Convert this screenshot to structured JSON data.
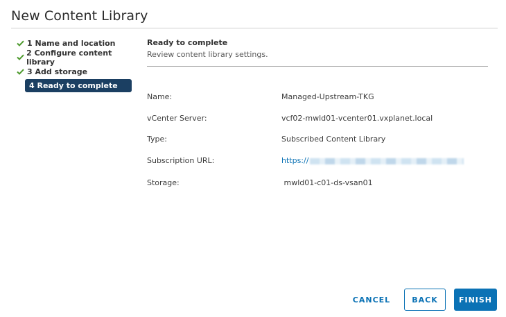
{
  "dialog": {
    "title": "New Content Library"
  },
  "steps": [
    {
      "label": "1 Name and location",
      "status": "completed",
      "icon": "check-icon"
    },
    {
      "label": "2 Configure content library",
      "status": "completed",
      "icon": "check-icon"
    },
    {
      "label": "3 Add storage",
      "status": "completed",
      "icon": "check-icon"
    },
    {
      "label": "4 Ready to complete",
      "status": "active"
    }
  ],
  "section": {
    "heading": "Ready to complete",
    "subheading": "Review content library settings."
  },
  "summary": [
    {
      "label": "Name:",
      "value": "Managed-Upstream-TKG"
    },
    {
      "label": "vCenter Server:",
      "value": "vcf02-mwld01-vcenter01.vxplanet.local"
    },
    {
      "label": "Type:",
      "value": "Subscribed Content Library"
    },
    {
      "label": "Subscription URL:",
      "value": "https://",
      "is_link": true,
      "redacted": true
    },
    {
      "label": "Storage:",
      "value": " mwld01-c01-ds-vsan01"
    }
  ],
  "buttons": {
    "cancel": "CANCEL",
    "back": "BACK",
    "finish": "FINISH"
  },
  "colors": {
    "accent": "#0b72b5",
    "active_step_bg": "#1b3f62",
    "check_green": "#4e9a2e"
  }
}
